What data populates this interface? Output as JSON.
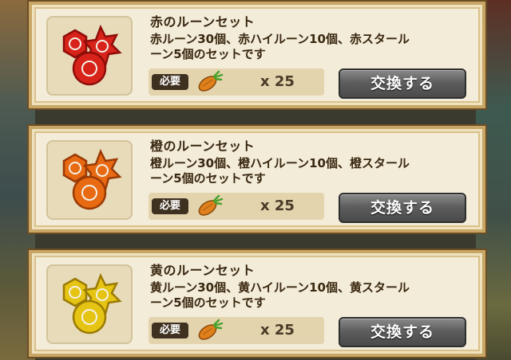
{
  "items": [
    {
      "title": "赤のルーンセット",
      "desc_line1": "赤ルーン30個、赤ハイルーン10個、赤スタール",
      "desc_line2": "ーン5個のセットです",
      "required_label": "必要",
      "quantity": "x 25",
      "button_label": "交換する",
      "rune_color": "#d8231b",
      "rune_dark": "#8e0d09",
      "rune_light": "#ff6a4e"
    },
    {
      "title": "橙のルーンセット",
      "desc_line1": "橙ルーン30個、橙ハイルーン10個、橙スタール",
      "desc_line2": "ーン5個のセットです",
      "required_label": "必要",
      "quantity": "x 25",
      "button_label": "交換する",
      "rune_color": "#e86a12",
      "rune_dark": "#9a3a06",
      "rune_light": "#ffa24a"
    },
    {
      "title": "黄のルーンセット",
      "desc_line1": "黄ルーン30個、黄ハイルーン10個、黄スタール",
      "desc_line2": "ーン5個のセットです",
      "required_label": "必要",
      "quantity": "x 25",
      "button_label": "交換する",
      "rune_color": "#e6c414",
      "rune_dark": "#9a7a04",
      "rune_light": "#fff06a"
    }
  ]
}
